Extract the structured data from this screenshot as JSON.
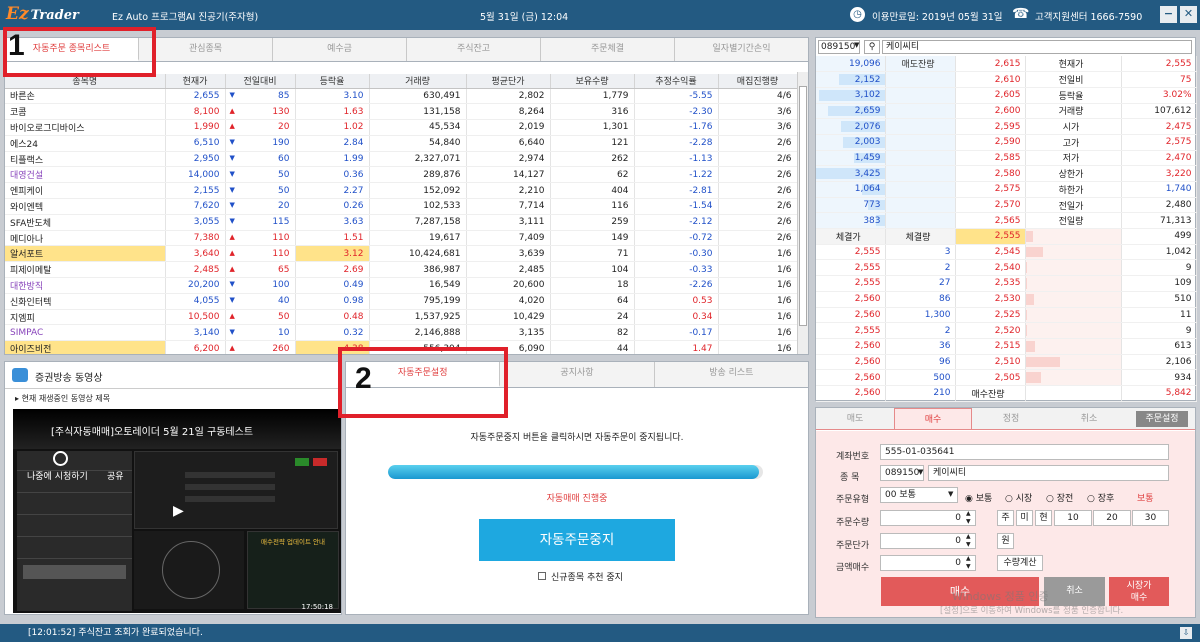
{
  "titlebar": {
    "logo": "Ez",
    "logo_sub": "Trader",
    "app_title": "Ez Auto 프로그램AI 진공기(주자형)",
    "datetime": "5월 31일 (금) 12:04",
    "expire": "이용만료일: 2019년 05월 31일",
    "support": "고객지원센터 1666-7590",
    "minimize": "−",
    "close": "✕"
  },
  "left_tabs": [
    "자동주문 종목리스트",
    "관심종목",
    "예수금",
    "주식잔고",
    "주문체결",
    "일자별기간손익"
  ],
  "columns": [
    "종목명",
    "현재가",
    "전일대비",
    "등락율",
    "거래량",
    "평균단가",
    "보유수량",
    "추정수익률",
    "매집진행량"
  ],
  "rows": [
    {
      "name": "바른손",
      "price": "2,655",
      "dir": "▼",
      "chg": "85",
      "rate": "3.10",
      "vol": "630,491",
      "avg": "2,802",
      "qty": "1,779",
      "pl": "-5.55",
      "prog": "4/6",
      "nc": "",
      "pc": "down",
      "rc": "down",
      "plc": "down",
      "hl": false
    },
    {
      "name": "코콤",
      "price": "8,100",
      "dir": "▲",
      "chg": "130",
      "rate": "1.63",
      "vol": "131,158",
      "avg": "8,264",
      "qty": "316",
      "pl": "-2.30",
      "prog": "3/6",
      "nc": "",
      "pc": "up",
      "rc": "up",
      "plc": "down",
      "hl": false
    },
    {
      "name": "바이오로그디바이스",
      "price": "1,990",
      "dir": "▲",
      "chg": "20",
      "rate": "1.02",
      "vol": "45,534",
      "avg": "2,019",
      "qty": "1,301",
      "pl": "-1.76",
      "prog": "3/6",
      "nc": "",
      "pc": "up",
      "rc": "up",
      "plc": "down",
      "hl": false
    },
    {
      "name": "에스24",
      "price": "6,510",
      "dir": "▼",
      "chg": "190",
      "rate": "2.84",
      "vol": "54,840",
      "avg": "6,640",
      "qty": "121",
      "pl": "-2.28",
      "prog": "2/6",
      "nc": "",
      "pc": "down",
      "rc": "down",
      "plc": "down",
      "hl": false
    },
    {
      "name": "티플랙스",
      "price": "2,950",
      "dir": "▼",
      "chg": "60",
      "rate": "1.99",
      "vol": "2,327,071",
      "avg": "2,974",
      "qty": "262",
      "pl": "-1.13",
      "prog": "2/6",
      "nc": "",
      "pc": "down",
      "rc": "down",
      "plc": "down",
      "hl": false
    },
    {
      "name": "대영건설",
      "price": "14,000",
      "dir": "▼",
      "chg": "50",
      "rate": "0.36",
      "vol": "289,876",
      "avg": "14,127",
      "qty": "62",
      "pl": "-1.22",
      "prog": "2/6",
      "nc": "purple",
      "pc": "down",
      "rc": "down",
      "plc": "down",
      "hl": false
    },
    {
      "name": "엔피케이",
      "price": "2,155",
      "dir": "▼",
      "chg": "50",
      "rate": "2.27",
      "vol": "152,092",
      "avg": "2,210",
      "qty": "404",
      "pl": "-2.81",
      "prog": "2/6",
      "nc": "",
      "pc": "down",
      "rc": "down",
      "plc": "down",
      "hl": false
    },
    {
      "name": "와이엔텍",
      "price": "7,620",
      "dir": "▼",
      "chg": "20",
      "rate": "0.26",
      "vol": "102,533",
      "avg": "7,714",
      "qty": "116",
      "pl": "-1.54",
      "prog": "2/6",
      "nc": "",
      "pc": "down",
      "rc": "down",
      "plc": "down",
      "hl": false
    },
    {
      "name": "SFA반도체",
      "price": "3,055",
      "dir": "▼",
      "chg": "115",
      "rate": "3.63",
      "vol": "7,287,158",
      "avg": "3,111",
      "qty": "259",
      "pl": "-2.12",
      "prog": "2/6",
      "nc": "",
      "pc": "down",
      "rc": "down",
      "plc": "down",
      "hl": false
    },
    {
      "name": "메디아나",
      "price": "7,380",
      "dir": "▲",
      "chg": "110",
      "rate": "1.51",
      "vol": "19,617",
      "avg": "7,409",
      "qty": "149",
      "pl": "-0.72",
      "prog": "2/6",
      "nc": "",
      "pc": "up",
      "rc": "up",
      "plc": "down",
      "hl": false
    },
    {
      "name": "알서포트",
      "price": "3,640",
      "dir": "▲",
      "chg": "110",
      "rate": "3.12",
      "vol": "10,424,681",
      "avg": "3,639",
      "qty": "71",
      "pl": "-0.30",
      "prog": "1/6",
      "nc": "",
      "pc": "up",
      "rc": "up",
      "plc": "down",
      "hl": true
    },
    {
      "name": "피제이메탈",
      "price": "2,485",
      "dir": "▲",
      "chg": "65",
      "rate": "2.69",
      "vol": "386,987",
      "avg": "2,485",
      "qty": "104",
      "pl": "-0.33",
      "prog": "1/6",
      "nc": "",
      "pc": "up",
      "rc": "up",
      "plc": "down",
      "hl": false
    },
    {
      "name": "대한방직",
      "price": "20,200",
      "dir": "▼",
      "chg": "100",
      "rate": "0.49",
      "vol": "16,549",
      "avg": "20,600",
      "qty": "18",
      "pl": "-2.26",
      "prog": "1/6",
      "nc": "purple",
      "pc": "down",
      "rc": "down",
      "plc": "down",
      "hl": false
    },
    {
      "name": "신화인터텍",
      "price": "4,055",
      "dir": "▼",
      "chg": "40",
      "rate": "0.98",
      "vol": "795,199",
      "avg": "4,020",
      "qty": "64",
      "pl": "0.53",
      "prog": "1/6",
      "nc": "",
      "pc": "down",
      "rc": "down",
      "plc": "up",
      "hl": false
    },
    {
      "name": "지엠피",
      "price": "10,500",
      "dir": "▲",
      "chg": "50",
      "rate": "0.48",
      "vol": "1,537,925",
      "avg": "10,429",
      "qty": "24",
      "pl": "0.34",
      "prog": "1/6",
      "nc": "",
      "pc": "up",
      "rc": "up",
      "plc": "up",
      "hl": false
    },
    {
      "name": "SIMPAC",
      "price": "3,140",
      "dir": "▼",
      "chg": "10",
      "rate": "0.32",
      "vol": "2,146,888",
      "avg": "3,135",
      "qty": "82",
      "pl": "-0.17",
      "prog": "1/6",
      "nc": "purple",
      "pc": "down",
      "rc": "down",
      "plc": "down",
      "hl": false
    },
    {
      "name": "아이즈비전",
      "price": "6,200",
      "dir": "▲",
      "chg": "260",
      "rate": "4.38",
      "vol": "556,304",
      "avg": "6,090",
      "qty": "44",
      "pl": "1.47",
      "prog": "1/6",
      "nc": "",
      "pc": "up",
      "rc": "up",
      "plc": "up",
      "hl": true
    }
  ],
  "video": {
    "title": "증권방송 동영상",
    "now_playing": "현재 재생중인 동영상 제목",
    "clip_title": "[주식자동매매]오토레이더 5월 21일 구동테스트",
    "watch_later": "나중에 시청하기",
    "share": "공유",
    "promo": "매수전략 업데이트 안내",
    "timestamp": "17:50:18"
  },
  "auto_tabs": [
    "자동주문설정",
    "공지사항",
    "방송 리스트"
  ],
  "auto": {
    "instruction": "자동주문중지 버튼을 클릭하시면 자동주문이 중지됩니다.",
    "progress": 0.99,
    "status": "자동매매 진행중",
    "stop_button": "자동주문중지",
    "no_new_label": "신규종목 추천 중지"
  },
  "quote": {
    "code": "089150",
    "name": "케이씨티",
    "sell_label": "매도잔량",
    "buy_label": "매수잔량",
    "exec_price_label": "체결가",
    "exec_qty_label": "체결량",
    "asks": [
      {
        "qty": "19,096",
        "price": "2,615",
        "pct": 0
      },
      {
        "qty": "2,152",
        "price": "2,610",
        "pct": 0.66
      },
      {
        "qty": "3,102",
        "price": "2,605",
        "pct": 0.95
      },
      {
        "qty": "2,659",
        "price": "2,600",
        "pct": 0.82
      },
      {
        "qty": "2,076",
        "price": "2,595",
        "pct": 0.64
      },
      {
        "qty": "2,003",
        "price": "2,590",
        "pct": 0.61
      },
      {
        "qty": "1,459",
        "price": "2,585",
        "pct": 0.45
      },
      {
        "qty": "3,425",
        "price": "2,580",
        "pct": 1.0
      },
      {
        "qty": "1,064",
        "price": "2,575",
        "pct": 0.33
      },
      {
        "qty": "773",
        "price": "2,570",
        "pct": 0.24
      },
      {
        "qty": "383",
        "price": "2,565",
        "pct": 0.12
      }
    ],
    "bids": [
      {
        "price": "2,555",
        "qty": "499",
        "pct": 0.08
      },
      {
        "price": "2,545",
        "qty": "1,042",
        "pct": 0.18
      },
      {
        "price": "2,540",
        "qty": "9",
        "pct": 0.01
      },
      {
        "price": "2,535",
        "qty": "109",
        "pct": 0.02
      },
      {
        "price": "2,530",
        "qty": "510",
        "pct": 0.09
      },
      {
        "price": "2,525",
        "qty": "11",
        "pct": 0.01
      },
      {
        "price": "2,520",
        "qty": "9",
        "pct": 0.01
      },
      {
        "price": "2,515",
        "qty": "613",
        "pct": 0.1
      },
      {
        "price": "2,510",
        "qty": "2,106",
        "pct": 0.36
      },
      {
        "price": "2,505",
        "qty": "934",
        "pct": 0.16
      }
    ],
    "ticks": [
      {
        "price": "2,555",
        "qty": "3"
      },
      {
        "price": "2,555",
        "qty": "2"
      },
      {
        "price": "2,555",
        "qty": "27"
      },
      {
        "price": "2,560",
        "qty": "86"
      },
      {
        "price": "2,560",
        "qty": "1,300"
      },
      {
        "price": "2,555",
        "qty": "2"
      },
      {
        "price": "2,560",
        "qty": "36"
      },
      {
        "price": "2,560",
        "qty": "96"
      },
      {
        "price": "2,560",
        "qty": "500"
      },
      {
        "price": "2,560",
        "qty": "210"
      }
    ],
    "current_bid": "2,555",
    "total_sell": "",
    "total_buy_label": "매수잔량",
    "total_buy": "5,842",
    "info": [
      {
        "k": "현재가",
        "v": "2,555",
        "c": "up"
      },
      {
        "k": "전일비",
        "v": "75",
        "c": "up"
      },
      {
        "k": "등락율",
        "v": "3.02%",
        "c": "up"
      },
      {
        "k": "거래량",
        "v": "107,612",
        "c": ""
      },
      {
        "k": "시가",
        "v": "2,475",
        "c": "up"
      },
      {
        "k": "고가",
        "v": "2,575",
        "c": "up"
      },
      {
        "k": "저가",
        "v": "2,470",
        "c": "up"
      },
      {
        "k": "상한가",
        "v": "3,220",
        "c": "up"
      },
      {
        "k": "하한가",
        "v": "1,740",
        "c": "down"
      },
      {
        "k": "전일가",
        "v": "2,480",
        "c": ""
      },
      {
        "k": "전일량",
        "v": "71,313",
        "c": ""
      }
    ]
  },
  "order": {
    "tabs": [
      "매도",
      "매수",
      "정정",
      "취소"
    ],
    "setting_btn": "주문설정",
    "account_label": "계좌번호",
    "account": "555-01-035641",
    "stock_label": "종 목",
    "code": "089150",
    "name": "케이씨티",
    "type_label": "주문유형",
    "type_value": "00 보통",
    "radios": [
      "보통",
      "시장",
      "장전",
      "장후"
    ],
    "radio_selected": "보통",
    "type_status": "보통",
    "qty_label": "주문수량",
    "qty": "0",
    "qty_btns": [
      "주",
      "미",
      "현"
    ],
    "qty_presets": [
      "10",
      "20",
      "30"
    ],
    "price_label": "주문단가",
    "price": "0",
    "won": "원",
    "amount_label": "금액매수",
    "amount": "0",
    "calc_btn": "수량계산",
    "buy_btn": "매수",
    "cancel_btn": "취소",
    "market_buy_l1": "시장가",
    "market_buy_l2": "매수"
  },
  "annotations": {
    "one": "1",
    "two": "2"
  },
  "watermark": {
    "l1": "Windows 정품 인증",
    "l2": "[설정]으로 이동하여 Windows를 정품 인증합니다."
  },
  "statusbar": {
    "message": "[12:01:52] 주식잔고 조회가 완료되었습니다."
  }
}
